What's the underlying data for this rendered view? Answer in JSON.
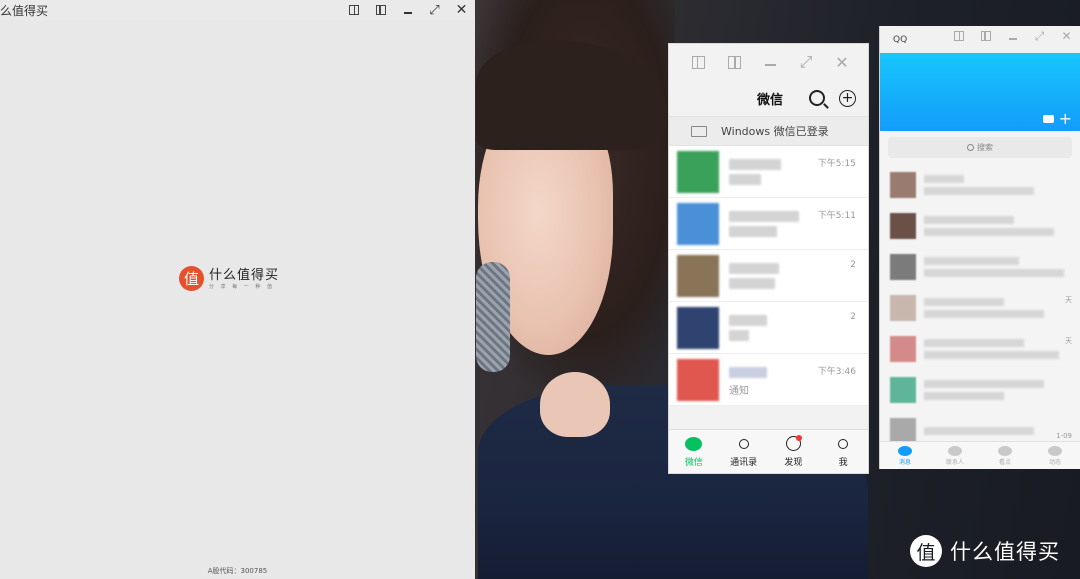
{
  "left_window": {
    "title": "么值得买",
    "brand_logo_glyph": "值",
    "brand_name": "什么值得买",
    "brand_slogan": "分 享 每 一 种 值",
    "stock_code": "A股代码：300785",
    "bg_color": "#e8e8e8"
  },
  "wechat": {
    "title": "微信",
    "login_status": "Windows 微信已登录",
    "chats": [
      {
        "time": "下午5:15",
        "avatar_color": "#3aa15a",
        "sub": ""
      },
      {
        "time": "下午5:11",
        "avatar_color": "#4a90d9",
        "sub": ""
      },
      {
        "time": "2",
        "avatar_color": "#8a7458",
        "sub": ""
      },
      {
        "time": "2",
        "avatar_color": "#2f4370",
        "sub": ""
      },
      {
        "time": "下午3:46",
        "avatar_color": "#e0574f",
        "sub": "通知"
      }
    ],
    "nav": [
      {
        "label": "微信",
        "icon": "chat-icon"
      },
      {
        "label": "通讯录",
        "icon": "contacts-icon"
      },
      {
        "label": "发现",
        "icon": "compass-icon"
      },
      {
        "label": "我",
        "icon": "user-icon"
      }
    ],
    "accent": "#07c160"
  },
  "qq": {
    "title": "QQ",
    "search_placeholder": "搜索",
    "rows": [
      {
        "tag": "",
        "avatar_color": "#9a7b6f"
      },
      {
        "tag": "",
        "avatar_color": "#6b5048"
      },
      {
        "tag": "",
        "avatar_color": "#7b7b7b"
      },
      {
        "tag": "天",
        "avatar_color": "#c7b7ad"
      },
      {
        "tag": "天",
        "avatar_color": "#d48a8a"
      },
      {
        "tag": "",
        "avatar_color": "#5fb59a"
      },
      {
        "tag": "1-09",
        "avatar_color": "#a9a9a9"
      }
    ],
    "nav": [
      {
        "label": "消息"
      },
      {
        "label": "联系人"
      },
      {
        "label": "看点"
      },
      {
        "label": "动态"
      }
    ],
    "accent": "#139cfb"
  },
  "watermark": {
    "logo_glyph": "值",
    "text": "什么值得买"
  }
}
